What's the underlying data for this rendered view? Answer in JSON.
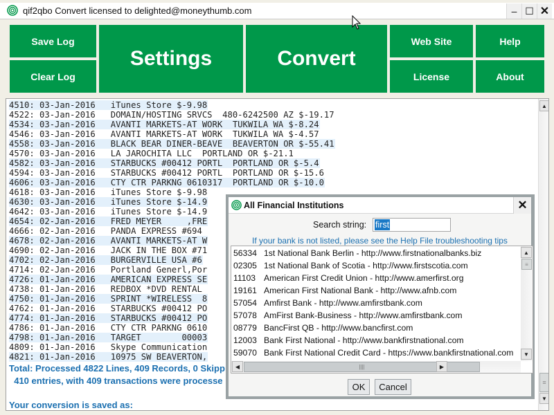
{
  "window": {
    "title": "qif2qbo Convert licensed to delighted@moneythumb.com",
    "controls": {
      "minimize": "–",
      "maximize": "☐",
      "close": "✕"
    }
  },
  "toolbar": {
    "save_log": "Save Log",
    "clear_log": "Clear Log",
    "settings": "Settings",
    "convert": "Convert",
    "web_site": "Web Site",
    "help": "Help",
    "license": "License",
    "about": "About"
  },
  "colors": {
    "brand_green": "#00984a",
    "link_blue": "#1a6fb0",
    "row_highlight": "#e3f0fb"
  },
  "log": {
    "lines": [
      {
        "text": "4510: 03-Jan-2016   iTunes Store $-9.98",
        "alt": true
      },
      {
        "text": "4522: 03-Jan-2016   DOMAIN/HOSTING SRVCS  480-6242500 AZ $-19.17",
        "alt": false
      },
      {
        "text": "4534: 03-Jan-2016   AVANTI MARKETS-AT WORK  TUKWILA WA $-8.24",
        "alt": true
      },
      {
        "text": "4546: 03-Jan-2016   AVANTI MARKETS-AT WORK  TUKWILA WA $-4.57",
        "alt": false
      },
      {
        "text": "4558: 03-Jan-2016   BLACK BEAR DINER-BEAVE  BEAVERTON OR $-55.41",
        "alt": true
      },
      {
        "text": "4570: 03-Jan-2016   LA JAROCHITA LLC  PORTLAND OR $-21.1",
        "alt": false
      },
      {
        "text": "4582: 03-Jan-2016   STARBUCKS #00412 PORTL  PORTLAND OR $-5.4",
        "alt": true
      },
      {
        "text": "4594: 03-Jan-2016   STARBUCKS #00412 PORTL  PORTLAND OR $-15.6",
        "alt": false
      },
      {
        "text": "4606: 03-Jan-2016   CTY CTR PARKNG 0610317  PORTLAND OR $-10.0",
        "alt": true
      },
      {
        "text": "4618: 03-Jan-2016   iTunes Store $-9.98",
        "alt": false
      },
      {
        "text": "4630: 03-Jan-2016   iTunes Store $-14.9",
        "alt": true
      },
      {
        "text": "4642: 03-Jan-2016   iTunes Store $-14.9",
        "alt": false
      },
      {
        "text": "4654: 02-Jan-2016   FRED MEYER     ,FRE",
        "alt": true
      },
      {
        "text": "4666: 02-Jan-2016   PANDA EXPRESS #694",
        "alt": false
      },
      {
        "text": "4678: 02-Jan-2016   AVANTI MARKETS-AT W",
        "alt": true
      },
      {
        "text": "4690: 02-Jan-2016   JACK IN THE BOX #71",
        "alt": false
      },
      {
        "text": "4702: 02-Jan-2016   BURGERVILLE USA #6",
        "alt": true
      },
      {
        "text": "4714: 02-Jan-2016   Portland Generl,Por",
        "alt": false
      },
      {
        "text": "4726: 01-Jan-2016   AMERICAN EXPRESS SE",
        "alt": true
      },
      {
        "text": "4738: 01-Jan-2016   REDBOX *DVD RENTAL",
        "alt": false
      },
      {
        "text": "4750: 01-Jan-2016   SPRINT *WIRELESS  8",
        "alt": true
      },
      {
        "text": "4762: 01-Jan-2016   STARBUCKS #00412 PO",
        "alt": false
      },
      {
        "text": "4774: 01-Jan-2016   STARBUCKS #00412 PO",
        "alt": true
      },
      {
        "text": "4786: 01-Jan-2016   CTY CTR PARKNG 0610",
        "alt": false
      },
      {
        "text": "4798: 01-Jan-2016   TARGET        00003",
        "alt": true
      },
      {
        "text": "4809: 01-Jan-2016   Skype Communication",
        "alt": false
      },
      {
        "text": "4821: 01-Jan-2016   10975 SW BEAVERTON,",
        "alt": true
      }
    ],
    "summary_total": "Total: Processed 4822 Lines, 409 Records, 0 Skipp",
    "summary_entries": "  410 entries, with 409 transactions were processe",
    "saved_as": "Your conversion is saved as:"
  },
  "dialog": {
    "title": "All Financial Institutions",
    "search_label": "Search string:",
    "search_value": "first",
    "hint": "If your bank is not listed, please see the Help File troubleshooting tips",
    "institutions": [
      {
        "code": "56334",
        "name": "1st National Bank Berlin - http://www.firstnationalbanks.biz"
      },
      {
        "code": "02305",
        "name": "1st National Bank of Scotia - http://www.firstscotia.com"
      },
      {
        "code": "11103",
        "name": "American First Credit Union - http://www.amerfirst.org"
      },
      {
        "code": "19161",
        "name": "American First National Bank - http://www.afnb.com"
      },
      {
        "code": "57054",
        "name": "Amfirst Bank - http://www.amfirstbank.com"
      },
      {
        "code": "57078",
        "name": "AmFirst Bank-Business - http://www.amfirstbank.com"
      },
      {
        "code": "08779",
        "name": "BancFirst QB - http://www.bancfirst.com"
      },
      {
        "code": "12003",
        "name": "Bank First National - http://www.bankfirstnational.com"
      },
      {
        "code": "59070",
        "name": "Bank First National Credit Card - https://www.bankfirstnational.com"
      }
    ],
    "ok_label": "OK",
    "cancel_label": "Cancel",
    "close_label": "✕"
  }
}
